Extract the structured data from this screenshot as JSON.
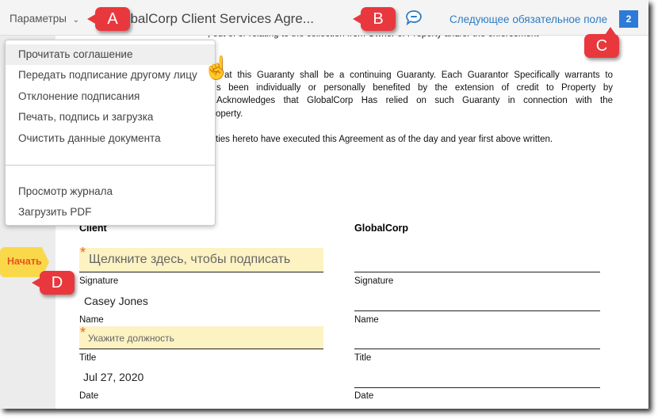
{
  "header": {
    "options_label": "Параметры",
    "doc_title": "GlobalCorp Client Services Agre...",
    "next_required_label": "Следующее обязательное поле",
    "next_required_count": "2",
    "accent": "#2d7cc4"
  },
  "callouts": [
    "A",
    "B",
    "C",
    "D"
  ],
  "menu": {
    "items": [
      "Прочитать соглашение",
      "Передать подписание другому лицу",
      "Отклонение подписания",
      "Печать, подпись и загрузка",
      "Очистить данные документа"
    ],
    "items2": [
      "Просмотр журнала",
      "Загрузить PDF"
    ]
  },
  "document": {
    "lines": [
      ", out of or relating to the collection from Owner of Property and/or the enforcement",
      "at this Guaranty shall be a continuing Guaranty. Each Guarantor Specifically warrants to",
      "s been individually or personally benefited by the extension of credit to Property by",
      "Acknowledges that GlobalCorp Has relied on such Guaranty in connection with the",
      "operty.",
      "ties hereto have executed this Agreement as of the day and year first above written."
    ],
    "start_label": "Начать",
    "client": {
      "heading": "Client",
      "signature_placeholder": "Щелкните здесь, чтобы подписать",
      "signature_label": "Signature",
      "name_value": "Casey Jones",
      "name_label": "Name",
      "title_placeholder": "Укажите должность",
      "title_label": "Title",
      "date_value": "Jul 27, 2020",
      "date_label": "Date"
    },
    "globalcorp": {
      "heading": "GlobalCorp",
      "signature_label": "Signature",
      "name_label": "Name",
      "title_label": "Title",
      "date_label": "Date"
    }
  }
}
